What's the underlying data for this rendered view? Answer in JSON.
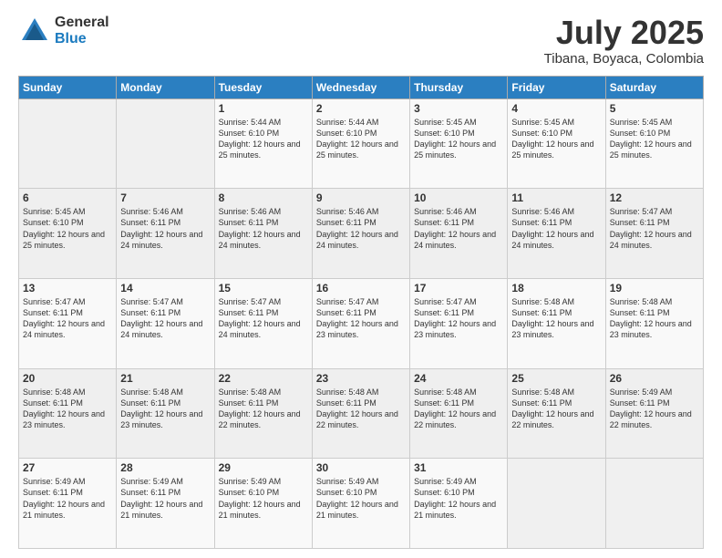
{
  "logo": {
    "general": "General",
    "blue": "Blue"
  },
  "header": {
    "month": "July 2025",
    "location": "Tibana, Boyaca, Colombia"
  },
  "weekdays": [
    "Sunday",
    "Monday",
    "Tuesday",
    "Wednesday",
    "Thursday",
    "Friday",
    "Saturday"
  ],
  "weeks": [
    [
      {
        "day": "",
        "info": ""
      },
      {
        "day": "",
        "info": ""
      },
      {
        "day": "1",
        "info": "Sunrise: 5:44 AM\nSunset: 6:10 PM\nDaylight: 12 hours and 25 minutes."
      },
      {
        "day": "2",
        "info": "Sunrise: 5:44 AM\nSunset: 6:10 PM\nDaylight: 12 hours and 25 minutes."
      },
      {
        "day": "3",
        "info": "Sunrise: 5:45 AM\nSunset: 6:10 PM\nDaylight: 12 hours and 25 minutes."
      },
      {
        "day": "4",
        "info": "Sunrise: 5:45 AM\nSunset: 6:10 PM\nDaylight: 12 hours and 25 minutes."
      },
      {
        "day": "5",
        "info": "Sunrise: 5:45 AM\nSunset: 6:10 PM\nDaylight: 12 hours and 25 minutes."
      }
    ],
    [
      {
        "day": "6",
        "info": "Sunrise: 5:45 AM\nSunset: 6:10 PM\nDaylight: 12 hours and 25 minutes."
      },
      {
        "day": "7",
        "info": "Sunrise: 5:46 AM\nSunset: 6:11 PM\nDaylight: 12 hours and 24 minutes."
      },
      {
        "day": "8",
        "info": "Sunrise: 5:46 AM\nSunset: 6:11 PM\nDaylight: 12 hours and 24 minutes."
      },
      {
        "day": "9",
        "info": "Sunrise: 5:46 AM\nSunset: 6:11 PM\nDaylight: 12 hours and 24 minutes."
      },
      {
        "day": "10",
        "info": "Sunrise: 5:46 AM\nSunset: 6:11 PM\nDaylight: 12 hours and 24 minutes."
      },
      {
        "day": "11",
        "info": "Sunrise: 5:46 AM\nSunset: 6:11 PM\nDaylight: 12 hours and 24 minutes."
      },
      {
        "day": "12",
        "info": "Sunrise: 5:47 AM\nSunset: 6:11 PM\nDaylight: 12 hours and 24 minutes."
      }
    ],
    [
      {
        "day": "13",
        "info": "Sunrise: 5:47 AM\nSunset: 6:11 PM\nDaylight: 12 hours and 24 minutes."
      },
      {
        "day": "14",
        "info": "Sunrise: 5:47 AM\nSunset: 6:11 PM\nDaylight: 12 hours and 24 minutes."
      },
      {
        "day": "15",
        "info": "Sunrise: 5:47 AM\nSunset: 6:11 PM\nDaylight: 12 hours and 24 minutes."
      },
      {
        "day": "16",
        "info": "Sunrise: 5:47 AM\nSunset: 6:11 PM\nDaylight: 12 hours and 23 minutes."
      },
      {
        "day": "17",
        "info": "Sunrise: 5:47 AM\nSunset: 6:11 PM\nDaylight: 12 hours and 23 minutes."
      },
      {
        "day": "18",
        "info": "Sunrise: 5:48 AM\nSunset: 6:11 PM\nDaylight: 12 hours and 23 minutes."
      },
      {
        "day": "19",
        "info": "Sunrise: 5:48 AM\nSunset: 6:11 PM\nDaylight: 12 hours and 23 minutes."
      }
    ],
    [
      {
        "day": "20",
        "info": "Sunrise: 5:48 AM\nSunset: 6:11 PM\nDaylight: 12 hours and 23 minutes."
      },
      {
        "day": "21",
        "info": "Sunrise: 5:48 AM\nSunset: 6:11 PM\nDaylight: 12 hours and 23 minutes."
      },
      {
        "day": "22",
        "info": "Sunrise: 5:48 AM\nSunset: 6:11 PM\nDaylight: 12 hours and 22 minutes."
      },
      {
        "day": "23",
        "info": "Sunrise: 5:48 AM\nSunset: 6:11 PM\nDaylight: 12 hours and 22 minutes."
      },
      {
        "day": "24",
        "info": "Sunrise: 5:48 AM\nSunset: 6:11 PM\nDaylight: 12 hours and 22 minutes."
      },
      {
        "day": "25",
        "info": "Sunrise: 5:48 AM\nSunset: 6:11 PM\nDaylight: 12 hours and 22 minutes."
      },
      {
        "day": "26",
        "info": "Sunrise: 5:49 AM\nSunset: 6:11 PM\nDaylight: 12 hours and 22 minutes."
      }
    ],
    [
      {
        "day": "27",
        "info": "Sunrise: 5:49 AM\nSunset: 6:11 PM\nDaylight: 12 hours and 21 minutes."
      },
      {
        "day": "28",
        "info": "Sunrise: 5:49 AM\nSunset: 6:11 PM\nDaylight: 12 hours and 21 minutes."
      },
      {
        "day": "29",
        "info": "Sunrise: 5:49 AM\nSunset: 6:10 PM\nDaylight: 12 hours and 21 minutes."
      },
      {
        "day": "30",
        "info": "Sunrise: 5:49 AM\nSunset: 6:10 PM\nDaylight: 12 hours and 21 minutes."
      },
      {
        "day": "31",
        "info": "Sunrise: 5:49 AM\nSunset: 6:10 PM\nDaylight: 12 hours and 21 minutes."
      },
      {
        "day": "",
        "info": ""
      },
      {
        "day": "",
        "info": ""
      }
    ]
  ]
}
